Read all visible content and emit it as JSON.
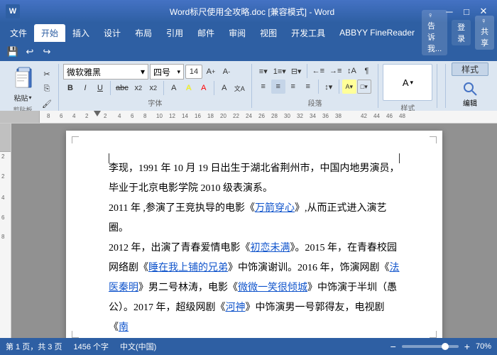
{
  "titlebar": {
    "title": "Word标尺使用全攻略.doc [兼容模式] - Word",
    "min": "─",
    "restore": "□",
    "close": "✕"
  },
  "menubar": {
    "items": [
      "文件",
      "开始",
      "插入",
      "设计",
      "布局",
      "引用",
      "邮件",
      "审阅",
      "视图",
      "开发工具",
      "ABBYY FineReader"
    ],
    "active_index": 1,
    "right": {
      "hint": "♀ 告诉我...",
      "login": "登录",
      "share": "♀ 共享"
    }
  },
  "ribbon": {
    "font_name": "微软雅黑",
    "font_size": "四号",
    "font_size_num": "14",
    "font_label": "字体",
    "para_label": "段落",
    "style_label": "样式",
    "edit_label": "编辑",
    "clipboard_label": "剪贴板",
    "paste_label": "粘贴",
    "style_btn": "样式",
    "edit_btn": "编辑"
  },
  "quickaccess": {
    "save": "💾",
    "undo": "↩",
    "redo": "↪"
  },
  "ruler": {
    "marks": [
      "8",
      "6",
      "4",
      "2",
      "2",
      "4",
      "6",
      "8",
      "10",
      "12",
      "14",
      "16",
      "18",
      "20",
      "22",
      "24",
      "26",
      "28",
      "30",
      "32",
      "34",
      "36",
      "38",
      "42",
      "44",
      "46",
      "48"
    ]
  },
  "document": {
    "paragraphs": [
      {
        "text": "李现，1991 年 10 月 19 日出生于湖北省荆州市，中国内地男演员，",
        "links": []
      },
      {
        "text": "毕业于北京电影学院 2010 级表演系。",
        "links": []
      },
      {
        "text_parts": [
          {
            "text": "2011 年 ,参演了王竞执导的电影《"
          },
          {
            "text": "万箭穿心",
            "link": true
          },
          {
            "text": "》,从而正式进入演艺圈。"
          }
        ]
      },
      {
        "text_parts": [
          {
            "text": "2012 年，出演了青春爱情电影《"
          },
          {
            "text": "初恋未满",
            "link": true
          },
          {
            "text": "》。2015 年，在青春校园网络剧《"
          },
          {
            "text": "睡在我上铺的兄弟",
            "link": true
          },
          {
            "text": "》中饰演谢训。2016 年，饰演网剧《"
          },
          {
            "text": "法医秦明",
            "link": true
          },
          {
            "text": "》男二号林涛，电影《"
          },
          {
            "text": "微微一笑很倾城",
            "link": true
          },
          {
            "text": "》中饰演于半圳（愚公）。2017 年，超级网剧《"
          },
          {
            "text": "河神",
            "link": true
          },
          {
            "text": "》中饰演男一号郭得友，电视剧《"
          },
          {
            "text": "南",
            "link": true
          }
        ]
      }
    ]
  },
  "statusbar": {
    "page": "第 1 页，共 3 页",
    "words": "1456 个字",
    "language": "中文(中国)",
    "zoom": "70%"
  }
}
